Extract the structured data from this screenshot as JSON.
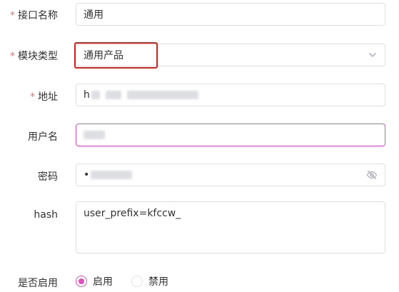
{
  "form": {
    "interface_name": {
      "required_mark": "*",
      "label": "接口名称",
      "value": "通用"
    },
    "module_type": {
      "required_mark": "*",
      "label": "模块类型",
      "value": "通用产品"
    },
    "address": {
      "required_mark": "*",
      "label": "地址",
      "value_prefix": "h"
    },
    "username": {
      "label": "用户名"
    },
    "password": {
      "label": "密码",
      "value_prefix": "•"
    },
    "hash": {
      "label": "hash",
      "value": "user_prefix=kfccw_"
    },
    "enabled": {
      "label": "是否启用",
      "options": [
        "启用",
        "禁用"
      ],
      "selected": "启用"
    }
  },
  "colors": {
    "accent": "#e14ec0",
    "required": "#f56c6c",
    "highlight": "#e0201b",
    "border": "#dcdfe6"
  },
  "icons": {
    "select_arrow": "chevron-down-icon",
    "password_toggle": "eye-off-icon"
  }
}
